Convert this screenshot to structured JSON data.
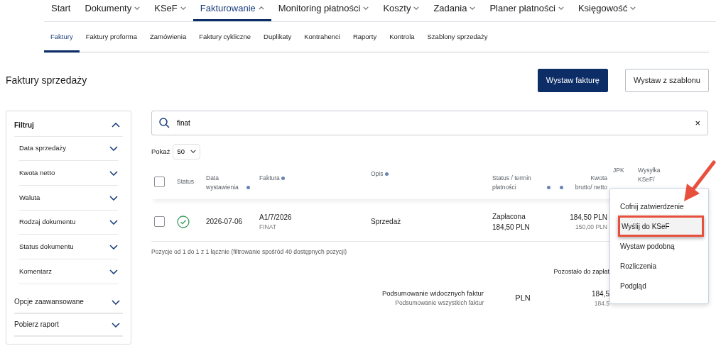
{
  "topnav": [
    {
      "label": "Start",
      "dropdown": false,
      "selected": false
    },
    {
      "label": "Dokumenty",
      "dropdown": true,
      "expanded": false,
      "selected": false
    },
    {
      "label": "KSeF",
      "dropdown": true,
      "expanded": false,
      "selected": false
    },
    {
      "label": "Fakturowanie",
      "dropdown": true,
      "expanded": true,
      "selected": true
    },
    {
      "label": "Monitoring płatności",
      "dropdown": true,
      "expanded": false,
      "selected": false
    },
    {
      "label": "Koszty",
      "dropdown": true,
      "expanded": false,
      "selected": false
    },
    {
      "label": "Zadania",
      "dropdown": true,
      "expanded": false,
      "selected": false
    },
    {
      "label": "Planer płatności",
      "dropdown": true,
      "expanded": false,
      "selected": false
    },
    {
      "label": "Księgowość",
      "dropdown": true,
      "expanded": false,
      "selected": false
    }
  ],
  "subnav": [
    {
      "label": "Faktury",
      "selected": true
    },
    {
      "label": "Faktury proforma",
      "selected": false
    },
    {
      "label": "Zamówienia",
      "selected": false
    },
    {
      "label": "Faktury cykliczne",
      "selected": false
    },
    {
      "label": "Duplikaty",
      "selected": false
    },
    {
      "label": "Kontrahenci",
      "selected": false
    },
    {
      "label": "Raporty",
      "selected": false
    },
    {
      "label": "Kontrola",
      "selected": false
    },
    {
      "label": "Szablony sprzedaży",
      "selected": false
    }
  ],
  "page_title": "Faktury sprzedaży",
  "buttons": [
    {
      "label": "Wystaw fakturę",
      "kind": "primary"
    },
    {
      "label": "Wystaw z szablonu",
      "kind": "outline"
    }
  ],
  "filters": {
    "title": "Filtruj",
    "expanded": true,
    "items": [
      {
        "label": "Data sprzedaży",
        "expanded": false
      },
      {
        "label": "Kwota netto",
        "expanded": false
      },
      {
        "label": "Waluta",
        "expanded": false
      },
      {
        "label": "Rodzaj dokumentu",
        "expanded": false
      },
      {
        "label": "Status dokumentu",
        "expanded": false
      },
      {
        "label": "Komentarz",
        "expanded": false
      }
    ],
    "sections": [
      {
        "label": "Opcje zaawansowane",
        "expanded": false
      },
      {
        "label": "Pobierz raport",
        "expanded": false
      }
    ]
  },
  "search": {
    "value": "finat",
    "clear": "×"
  },
  "page_size": {
    "label": "Pokaż",
    "value": "50"
  },
  "table": {
    "columns": [
      {
        "kind": "checkbox",
        "checked": false
      },
      {
        "kind": "text",
        "label": "Status",
        "sortable": false
      },
      {
        "kind": "text",
        "label": "Data wystawienia",
        "sortable": true
      },
      {
        "kind": "text",
        "label": "Faktura",
        "sortable": true
      },
      {
        "kind": "text",
        "label": "Opis",
        "sortable": true
      },
      {
        "kind": "text",
        "label": "Status / termin płatności",
        "sortable": true
      },
      {
        "kind": "amount",
        "label": "Kwota brutto/ netto",
        "sortable": true
      },
      {
        "kind": "text",
        "label": "JPK"
      },
      {
        "kind": "text",
        "label": "Wysyłka KSeF/"
      }
    ],
    "rows": [
      {
        "checked": false,
        "approved": true,
        "date": "2026-07-06",
        "invoice": "A1/7/2026",
        "invoice_sub": "FINAT",
        "description": "Sprzedaż",
        "payment_status": "Zapłacona",
        "payment_amount": "184,50 PLN",
        "gross": "184,50 PLN",
        "net": "150,00 PLN"
      }
    ]
  },
  "info": "Pozycje od 1 do 1 z 1 łącznie (filtrowanie spośród 40 dostępnych pozycji)",
  "summary": {
    "header": "Pozostało do zapłat",
    "rows": [
      {
        "label": "Podsumowanie widocznych faktur",
        "currency": "PLN",
        "amount": "184,5"
      },
      {
        "label": "Podsumowanie wszystkich faktur",
        "amount": "184.5"
      }
    ]
  },
  "context_menu": [
    {
      "label": "Cofnij zatwierdzenie",
      "selected": false
    },
    {
      "label": "Wyślij do KSeF",
      "selected": true
    },
    {
      "label": "Wystaw podobną",
      "selected": false
    },
    {
      "label": "Rozliczenia",
      "selected": false
    },
    {
      "label": "Podgląd",
      "selected": false
    }
  ]
}
